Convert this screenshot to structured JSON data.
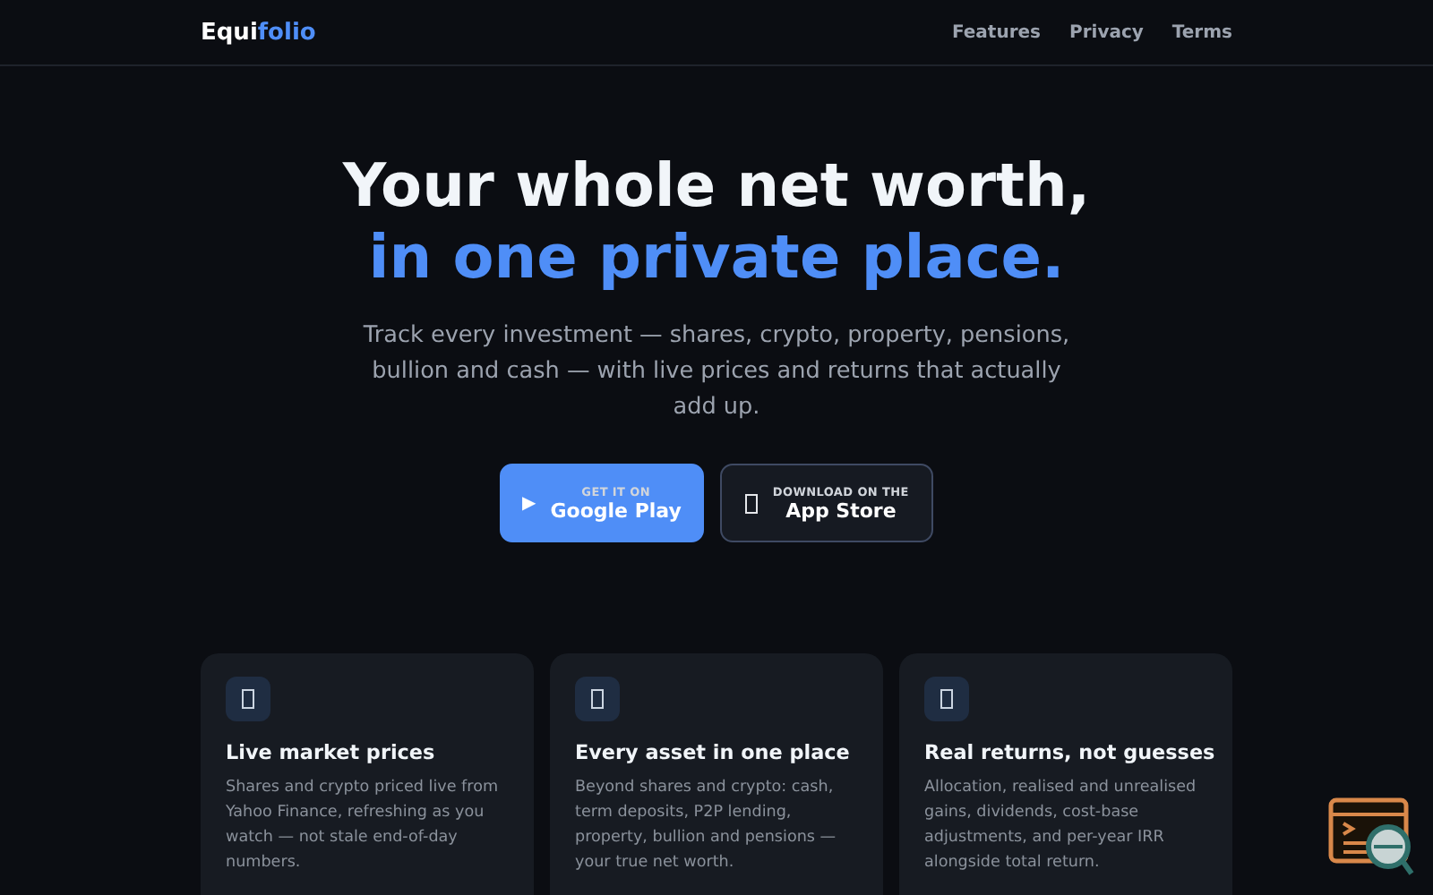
{
  "brand": {
    "first": "Equi",
    "second": "folio"
  },
  "nav": [
    "Features",
    "Privacy",
    "Terms"
  ],
  "hero": {
    "line1": "Your whole net worth,",
    "line2": "in one private place.",
    "text": "Track every investment — shares, crypto, property, pensions, bullion and cash — with live prices and returns that actually add up."
  },
  "buttons": [
    {
      "kind": "play",
      "small": "GET IT ON",
      "big": "Google Play",
      "icon": "▶",
      "primary": true
    },
    {
      "kind": "apple",
      "small": "DOWNLOAD ON THE",
      "big": "App Store",
      "primary": false
    }
  ],
  "features": [
    {
      "title": "Live market prices",
      "text": "Shares and crypto priced live from Yahoo Finance, refreshing as you watch — not stale end-of-day numbers."
    },
    {
      "title": "Every asset in one place",
      "text": "Beyond shares and crypto: cash, term deposits, P2P lending, property, bullion and pensions — your true net worth."
    },
    {
      "title": "Real returns, not guesses",
      "text": "Allocation, realised and unrealised gains, dividends, cost-base adjustments, and per-year IRR alongside total return."
    }
  ]
}
